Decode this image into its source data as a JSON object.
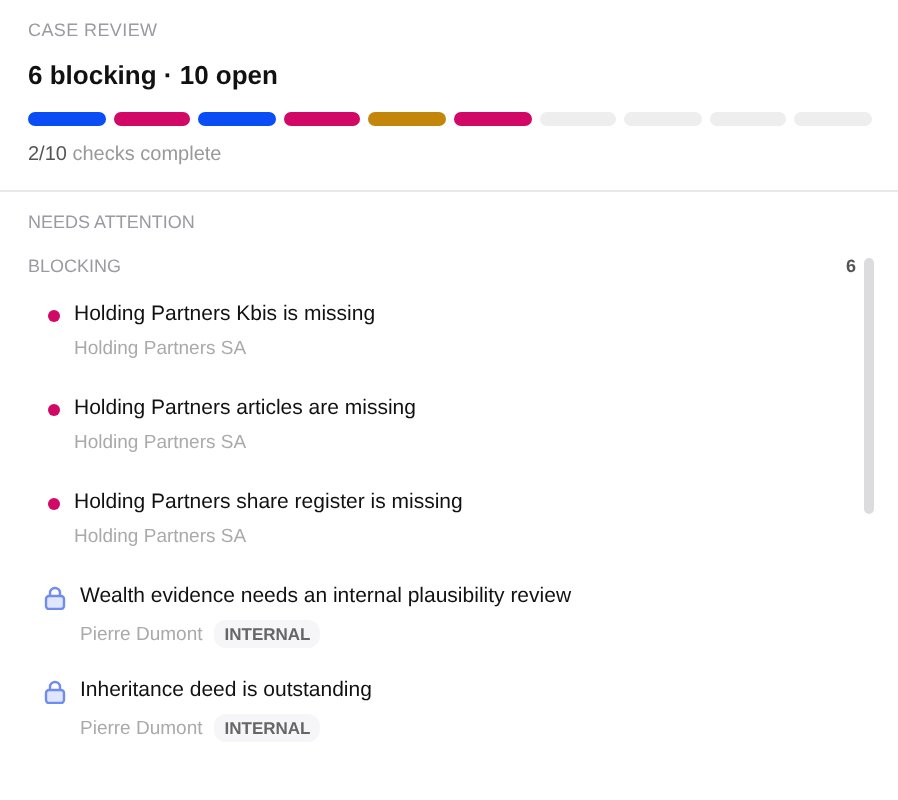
{
  "header": {
    "eyebrow": "CASE REVIEW",
    "title": "6 blocking · 10 open",
    "segments": [
      {
        "color": "#0a4df5"
      },
      {
        "color": "#d10865"
      },
      {
        "color": "#0a4df5"
      },
      {
        "color": "#d10865"
      },
      {
        "color": "#c4860a"
      },
      {
        "color": "#d10865"
      },
      {
        "color": "#eeeeee"
      },
      {
        "color": "#eeeeee"
      },
      {
        "color": "#eeeeee"
      },
      {
        "color": "#eeeeee"
      }
    ],
    "progress_count": "2/10",
    "progress_label": "checks complete"
  },
  "attention": {
    "heading": "NEEDS ATTENTION",
    "group": {
      "label": "BLOCKING",
      "count": "6",
      "items": [
        {
          "kind": "dot",
          "color": "#d10865",
          "title": "Holding Partners Kbis is missing",
          "subtitle": "Holding Partners SA"
        },
        {
          "kind": "dot",
          "color": "#d10865",
          "title": "Holding Partners articles are missing",
          "subtitle": "Holding Partners SA"
        },
        {
          "kind": "dot",
          "color": "#d10865",
          "title": "Holding Partners share register is missing",
          "subtitle": "Holding Partners SA"
        },
        {
          "kind": "lock",
          "title": "Wealth evidence needs an internal plausibility review",
          "subtitle": "Pierre Dumont",
          "tag": "INTERNAL"
        },
        {
          "kind": "lock",
          "title": "Inheritance deed is outstanding",
          "subtitle": "Pierre Dumont",
          "tag": "INTERNAL"
        }
      ]
    }
  }
}
